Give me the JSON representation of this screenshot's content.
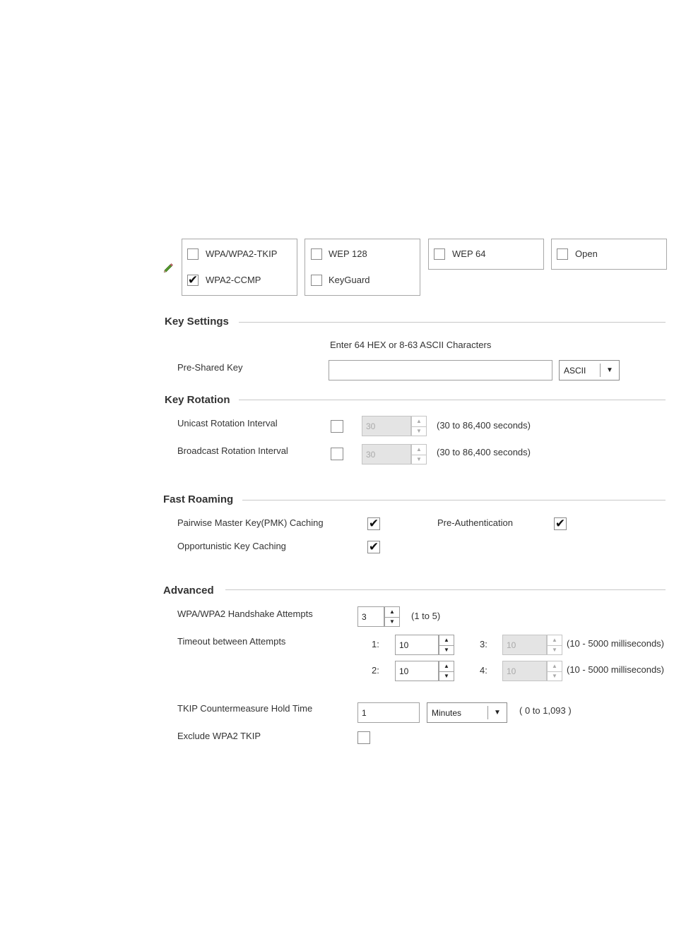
{
  "encryption": {
    "group1": {
      "opt1": "WPA/WPA2-TKIP",
      "opt1_checked": false,
      "opt2": "WPA2-CCMP",
      "opt2_checked": true
    },
    "group2": {
      "opt1": "WEP 128",
      "opt1_checked": false,
      "opt2": "KeyGuard",
      "opt2_checked": false
    },
    "group3": {
      "opt1": "WEP 64",
      "opt1_checked": false
    },
    "group4": {
      "opt1": "Open",
      "opt1_checked": false
    }
  },
  "key_settings": {
    "title": "Key Settings",
    "hint": "Enter 64 HEX or 8-63 ASCII Characters",
    "psk_label": "Pre-Shared Key",
    "psk_value": "",
    "format_value": "ASCII"
  },
  "key_rotation": {
    "title": "Key Rotation",
    "unicast_label": "Unicast Rotation Interval",
    "unicast_value": "30",
    "unicast_range": "(30 to 86,400 seconds)",
    "broadcast_label": "Broadcast Rotation Interval",
    "broadcast_value": "30",
    "broadcast_range": "(30 to 86,400 seconds)"
  },
  "fast_roaming": {
    "title": "Fast Roaming",
    "pmk_label": "Pairwise Master Key(PMK) Caching",
    "pmk_checked": true,
    "preauth_label": "Pre-Authentication",
    "preauth_checked": true,
    "okc_label": "Opportunistic Key Caching",
    "okc_checked": true
  },
  "advanced": {
    "title": "Advanced",
    "handshake_label": "WPA/WPA2 Handshake Attempts",
    "handshake_value": "3",
    "handshake_range": "(1 to 5)",
    "timeout_label": "Timeout between Attempts",
    "t1_label": "1:",
    "t1_value": "10",
    "t2_label": "2:",
    "t2_value": "10",
    "t3_label": "3:",
    "t3_value": "10",
    "t4_label": "4:",
    "t4_value": "10",
    "timeout_range": "(10 - 5000 milliseconds)",
    "tkip_label": "TKIP Countermeasure Hold Time",
    "tkip_value": "1",
    "tkip_unit": "Minutes",
    "tkip_range": "( 0 to 1,093 )",
    "exclude_label": "Exclude WPA2 TKIP",
    "exclude_checked": false
  },
  "icons": {
    "edit": "pencil-icon",
    "spin_up": "up-arrow-icon",
    "spin_down": "down-arrow-icon",
    "dropdown": "dropdown-arrow-icon"
  }
}
